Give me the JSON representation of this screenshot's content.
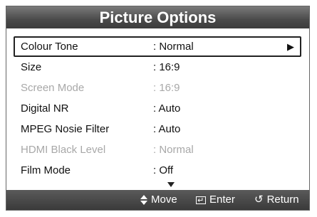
{
  "title": "Picture Options",
  "menu": {
    "items": [
      {
        "label": "Colour Tone",
        "value": ": Normal",
        "state": "selected",
        "has_submenu": true
      },
      {
        "label": "Size",
        "value": ": 16:9",
        "state": "enabled"
      },
      {
        "label": "Screen Mode",
        "value": ": 16:9",
        "state": "disabled"
      },
      {
        "label": "Digital NR",
        "value": ": Auto",
        "state": "enabled"
      },
      {
        "label": "MPEG Nosie Filter",
        "value": ": Auto",
        "state": "enabled"
      },
      {
        "label": "HDMI Black Level",
        "value": ": Normal",
        "state": "disabled"
      },
      {
        "label": "Film Mode",
        "value": ": Off",
        "state": "enabled"
      }
    ],
    "submenu_icon": "triangle-right-icon",
    "more_icon": "triangle-down-icon"
  },
  "footer": {
    "move": {
      "label": "Move",
      "icon": "up-down-arrow-icon"
    },
    "enter": {
      "label": "Enter",
      "icon": "enter-icon"
    },
    "return": {
      "label": "Return",
      "icon": "return-icon"
    }
  },
  "colors": {
    "title_bg": "#4a4a4a",
    "footer_bg": "#3a3a3a",
    "disabled_text": "#a8a8a8"
  }
}
